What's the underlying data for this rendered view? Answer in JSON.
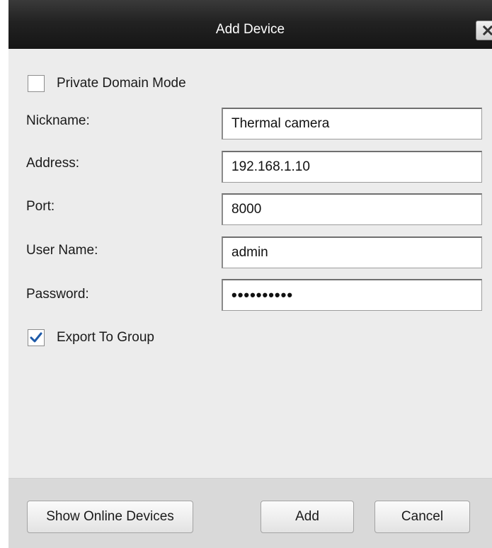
{
  "dialog": {
    "title": "Add Device"
  },
  "private_domain_mode": {
    "label": "Private Domain Mode",
    "checked": false
  },
  "fields": {
    "nickname": {
      "label": "Nickname:",
      "value": "Thermal camera"
    },
    "address": {
      "label": "Address:",
      "value": "192.168.1.10"
    },
    "port": {
      "label": "Port:",
      "value": "8000"
    },
    "username": {
      "label": "User Name:",
      "value": "admin"
    },
    "password": {
      "label": "Password:",
      "value": "••••••••••"
    }
  },
  "export_to_group": {
    "label": "Export To Group",
    "checked": true
  },
  "buttons": {
    "show_online_devices": "Show Online Devices",
    "add": "Add",
    "cancel": "Cancel"
  },
  "colors": {
    "titlebar": "#1e1e1e",
    "check_accent": "#1e5aa8"
  },
  "icons": {
    "close": "close-icon",
    "checkmark": "checkmark-icon"
  }
}
